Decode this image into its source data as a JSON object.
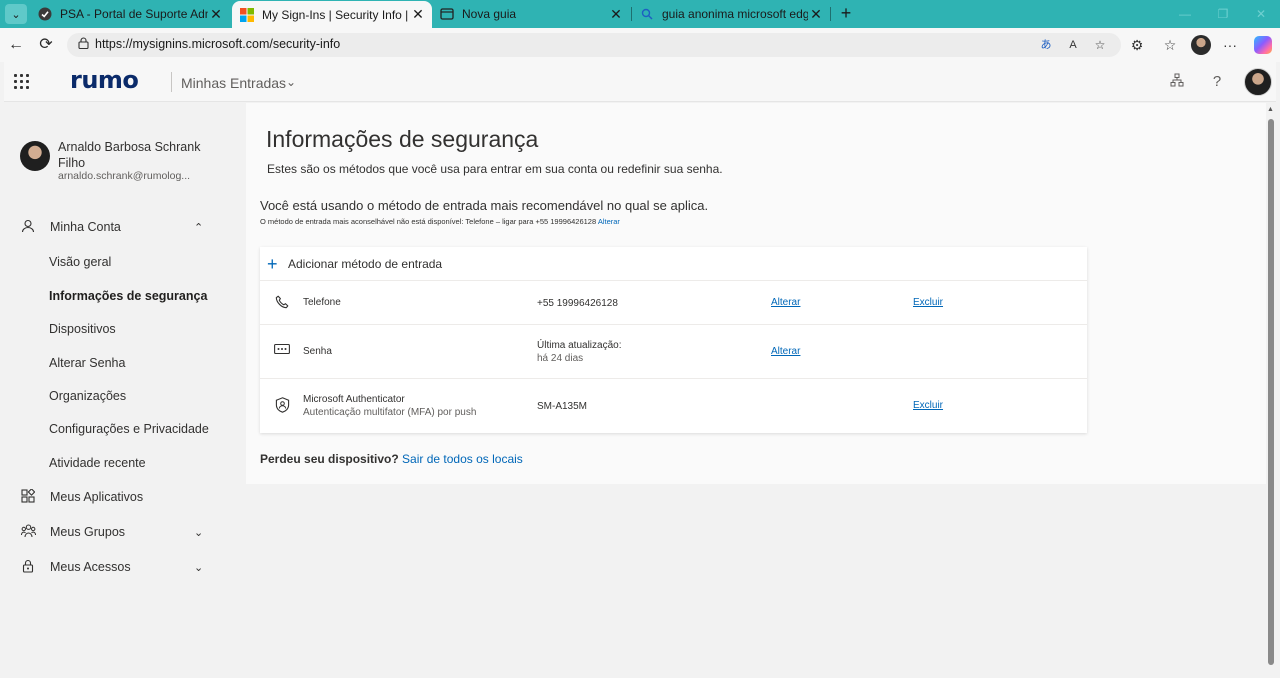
{
  "browser": {
    "tabs": [
      {
        "title": "PSA - Portal de Suporte Administr",
        "icon": "psa-favicon"
      },
      {
        "title": "My Sign-Ins | Security Info | Micro",
        "icon": "microsoft-favicon"
      },
      {
        "title": "Nova guia",
        "icon": "new-tab-favicon"
      },
      {
        "title": "guia anonima microsoft edge - Pe",
        "icon": "search-favicon"
      }
    ],
    "url": "https://mysignins.microsoft.com/security-info"
  },
  "header": {
    "logo": "rumo",
    "title": "Minhas Entradas"
  },
  "user": {
    "name": "Arnaldo Barbosa Schrank Filho",
    "email": "arnaldo.schrank@rumolog..."
  },
  "sidebar": {
    "account": "Minha Conta",
    "sub_items": [
      "Visão geral",
      "Informações de segurança",
      "Dispositivos",
      "Alterar Senha",
      "Organizações",
      "Configurações e Privacidade",
      "Atividade recente"
    ],
    "apps": "Meus Aplicativos",
    "groups": "Meus Grupos",
    "access": "Meus Acessos"
  },
  "main": {
    "title": "Informações de segurança",
    "description": "Estes são os métodos que você usa para entrar em sua conta ou redefinir sua senha.",
    "recommended": "Você está usando o método de entrada mais recomendável no qual se aplica.",
    "rec_note": "O método de entrada mais aconselhável não está disponível: Telefone – ligar para +55 19996426128",
    "rec_link": "Alterar",
    "add_method": "Adicionar método de entrada",
    "methods": [
      {
        "name": "Telefone",
        "sub": "",
        "detail_1": "+55 19996426128",
        "detail_2": "",
        "change": "Alterar",
        "delete": "Excluir"
      },
      {
        "name": "Senha",
        "sub": "",
        "detail_1": "Última atualização:",
        "detail_2": "há 24 dias",
        "change": "Alterar",
        "delete": ""
      },
      {
        "name": "Microsoft Authenticator",
        "sub": "Autenticação multifator (MFA) por push",
        "detail_1": "SM-A135M",
        "detail_2": "",
        "change": "",
        "delete": "Excluir"
      }
    ],
    "lost_q": "Perdeu seu dispositivo?",
    "lost_link": "Sair de todos os locais"
  },
  "colors": {
    "tab_bar": "#2fb3b3",
    "link": "#0067b8",
    "logo": "#0b2b6a"
  }
}
